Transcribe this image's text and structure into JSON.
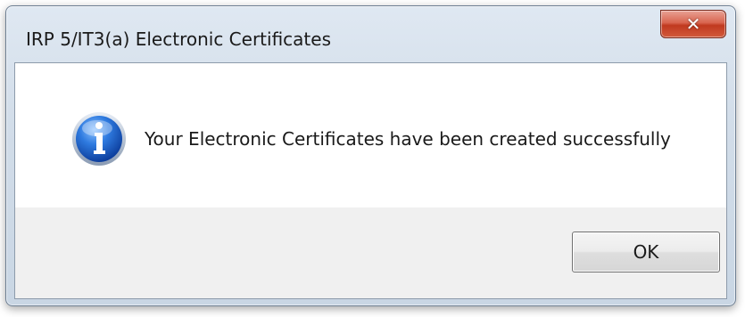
{
  "window": {
    "title": "IRP 5/IT3(a) Electronic Certificates",
    "close_icon": "close-icon"
  },
  "dialog": {
    "icon": "info-icon",
    "message": "Your Electronic Certificates have been created successfully",
    "ok_label": "OK"
  },
  "colors": {
    "close_button": "#c0391f",
    "info_icon_blue": "#1f5fc4",
    "button_area": "#f0f0f0"
  }
}
